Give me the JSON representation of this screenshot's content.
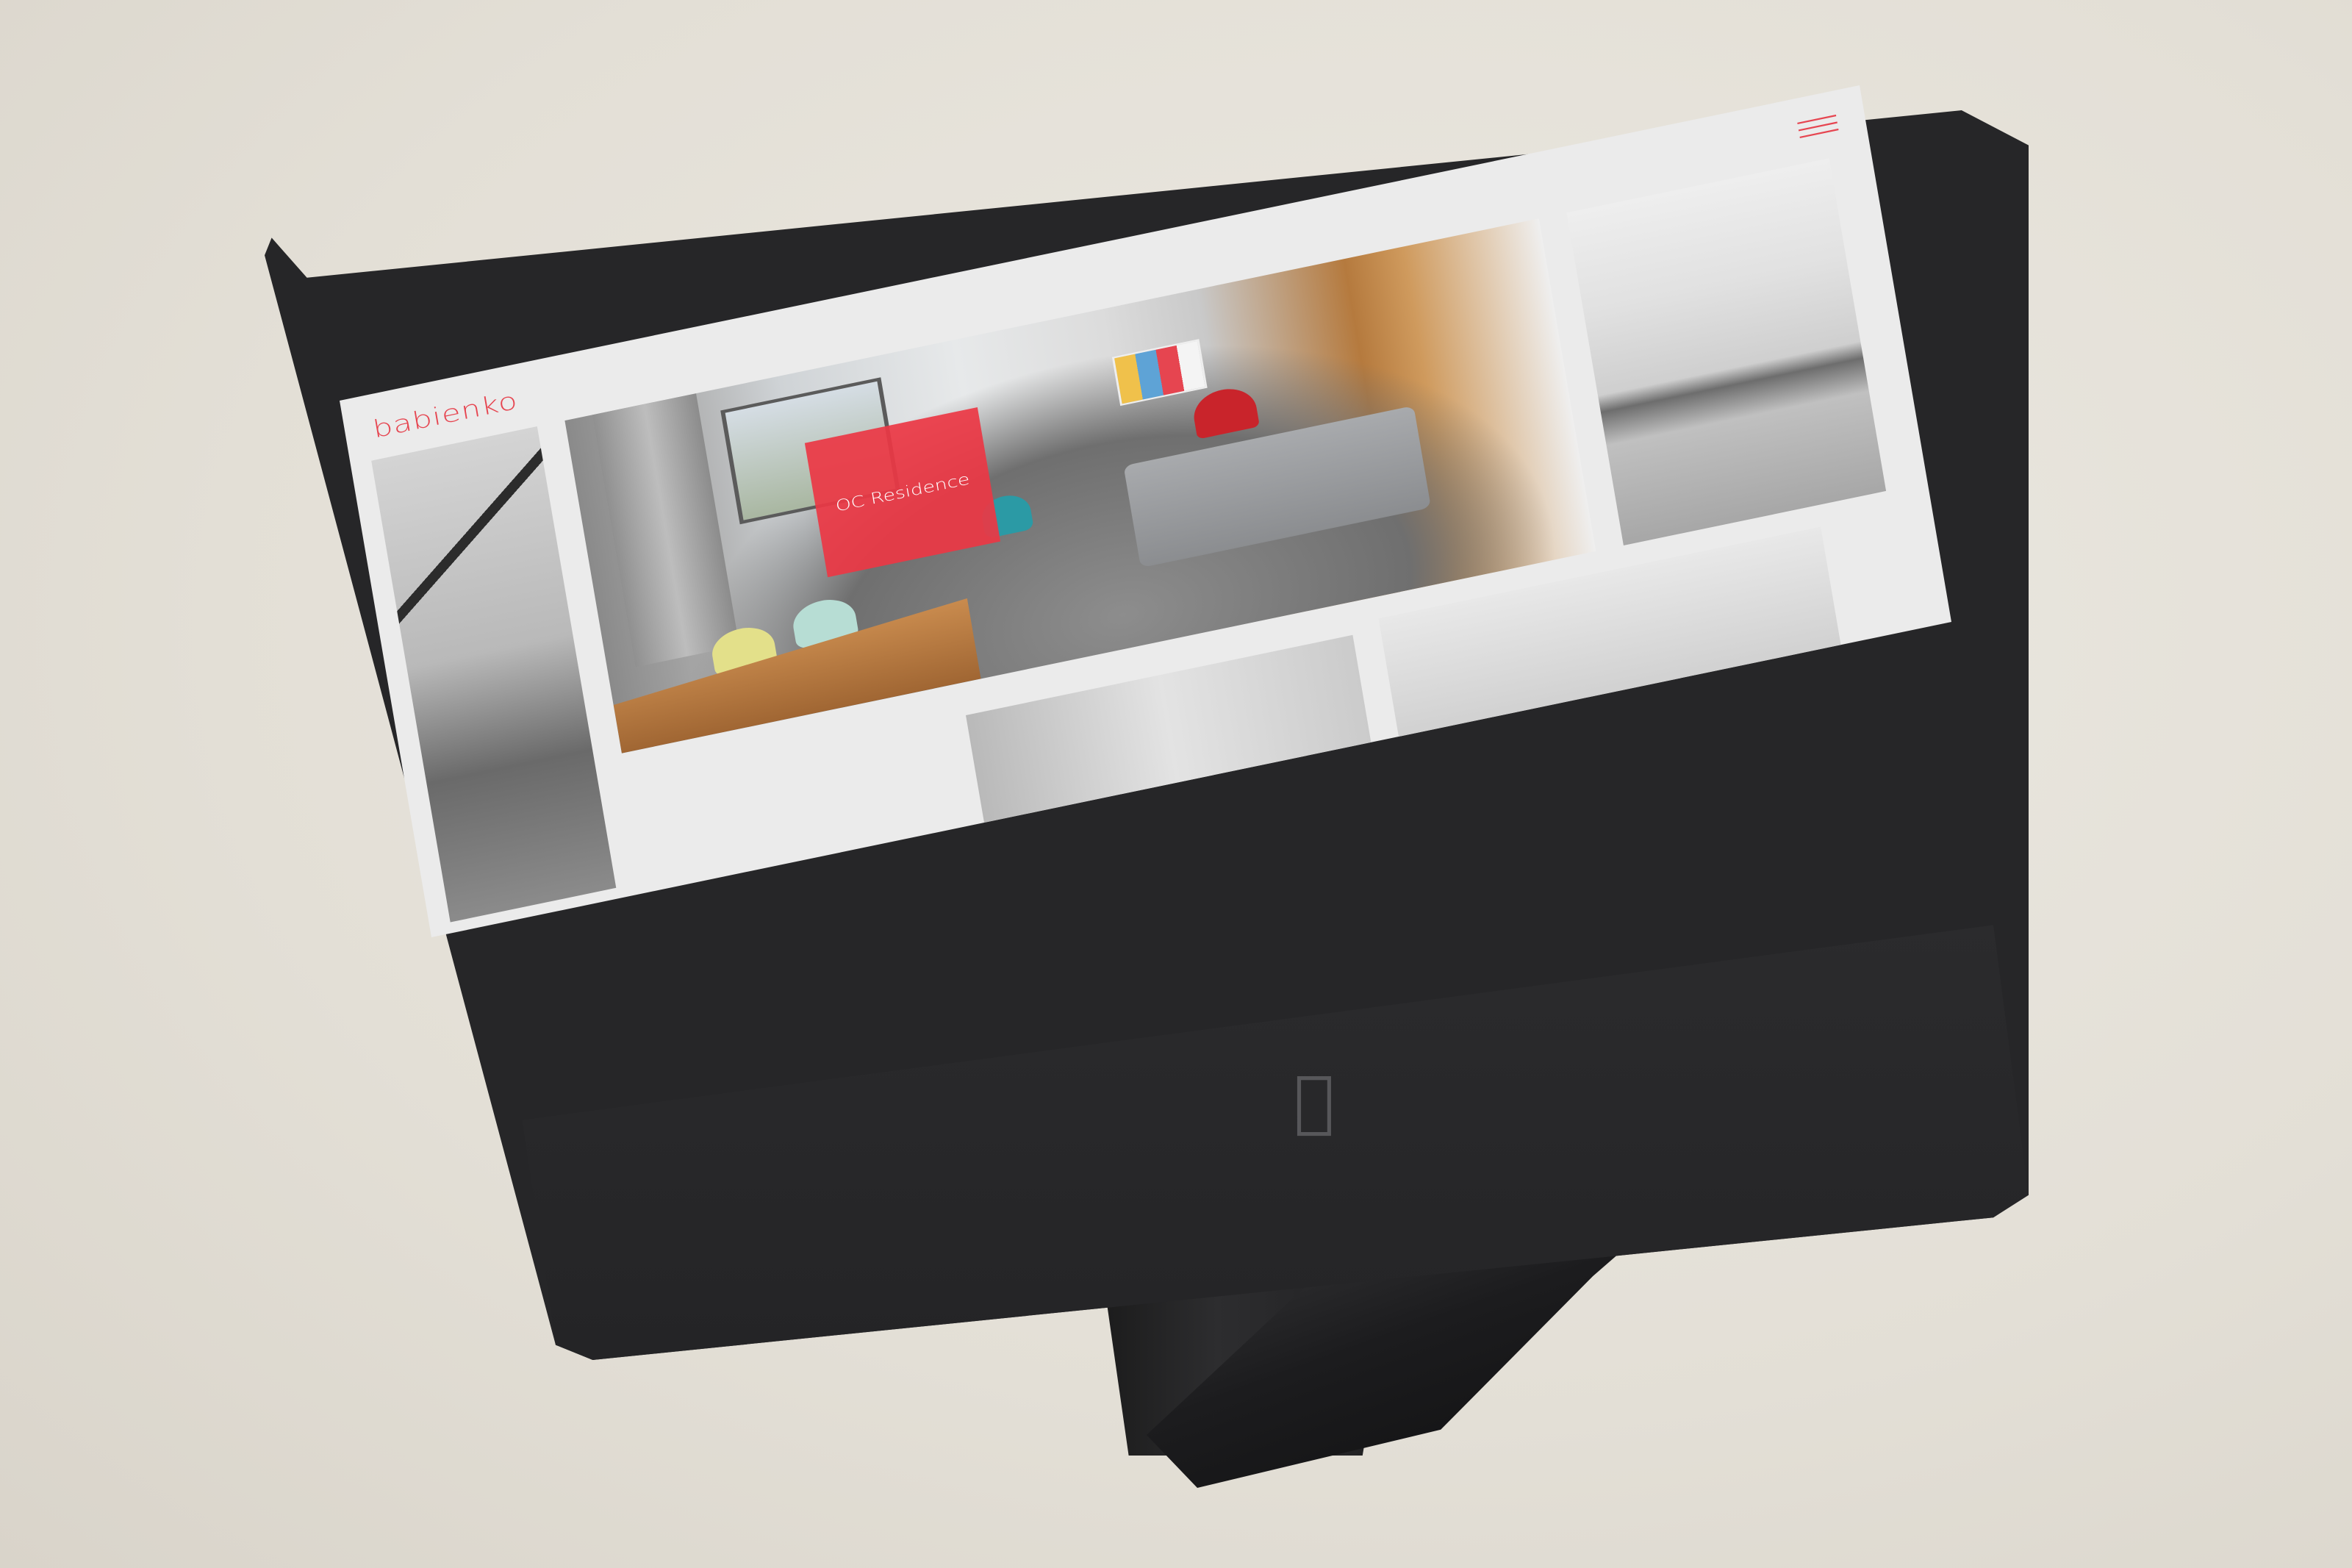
{
  "site": {
    "logo_text": "babienko",
    "accent_color": "#e64550",
    "menu_icon": "hamburger-icon"
  },
  "gallery": {
    "featured_project": {
      "title": "OC Residence"
    }
  },
  "device": {
    "brand_icon": "apple-logo-icon"
  }
}
